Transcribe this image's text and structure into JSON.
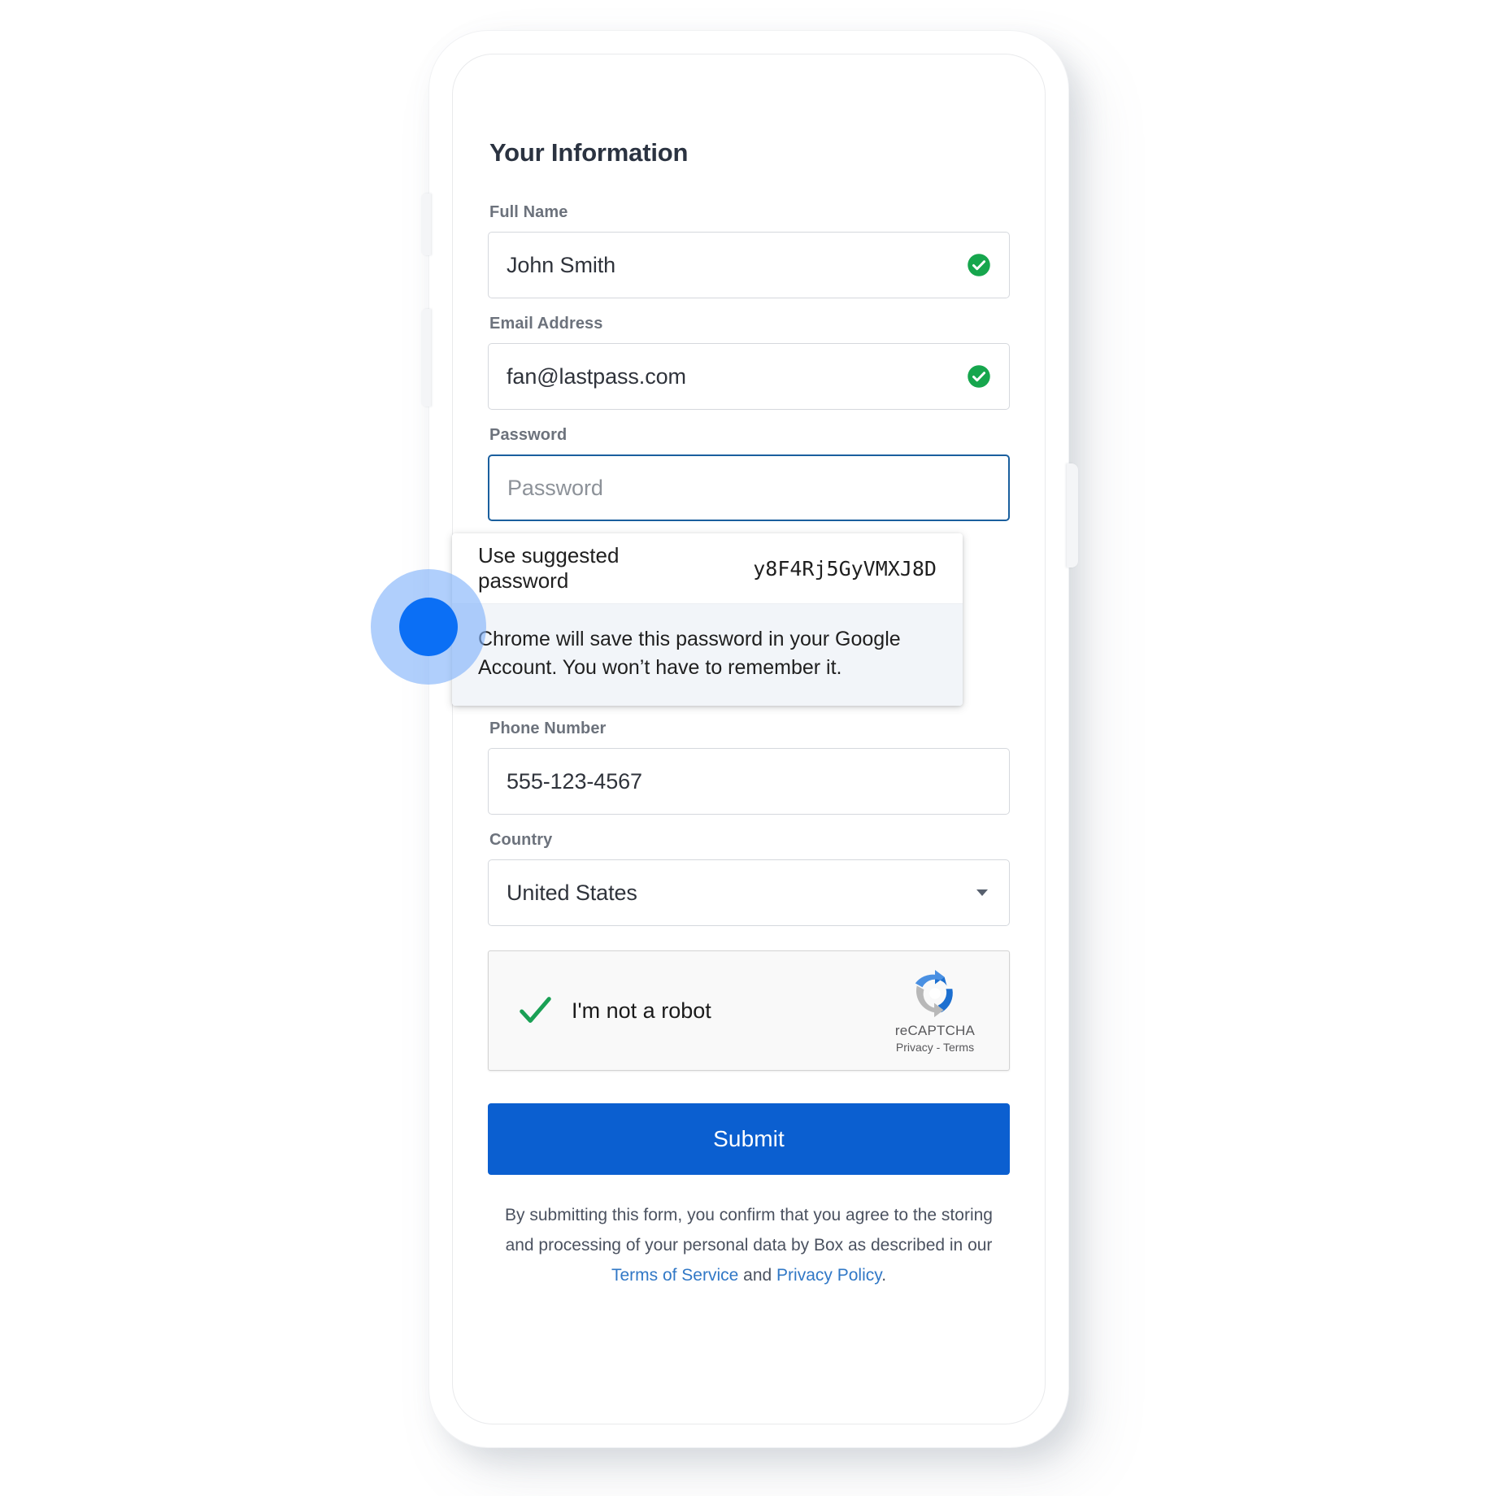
{
  "form": {
    "title": "Your Information",
    "fields": [
      {
        "label": "Full Name",
        "value": "John Smith",
        "valid": true
      },
      {
        "label": "Email Address",
        "value": "fan@lastpass.com",
        "valid": true
      },
      {
        "label": "Password",
        "placeholder": "Password",
        "value": ""
      },
      {
        "label": "Phone Number",
        "value": "555-123-4567",
        "valid": false
      },
      {
        "label": "Country",
        "value": "United States"
      }
    ]
  },
  "password_suggestion": {
    "label": "Use suggested password",
    "password": "y8F4Rj5GyVMXJ8D",
    "note": "Chrome will save this password in your Google Account. You won’t have to remember it."
  },
  "recaptcha": {
    "label": "I'm not a robot",
    "brand": "reCAPTCHA",
    "links": "Privacy - Terms"
  },
  "submit": {
    "label": "Submit"
  },
  "legal": {
    "text_before": "By submitting this form, you confirm that you agree to the storing and processing of your personal data by Box as described in our ",
    "terms_link": "Terms of Service",
    "conjunction": " and ",
    "privacy_link": "Privacy Policy",
    "text_after": "."
  },
  "colors": {
    "accent": "#0b5fd0",
    "link": "#3178c6",
    "valid": "#16a64d",
    "focus_border": "#1a5f9e",
    "cursor": "#0b6ff5"
  }
}
